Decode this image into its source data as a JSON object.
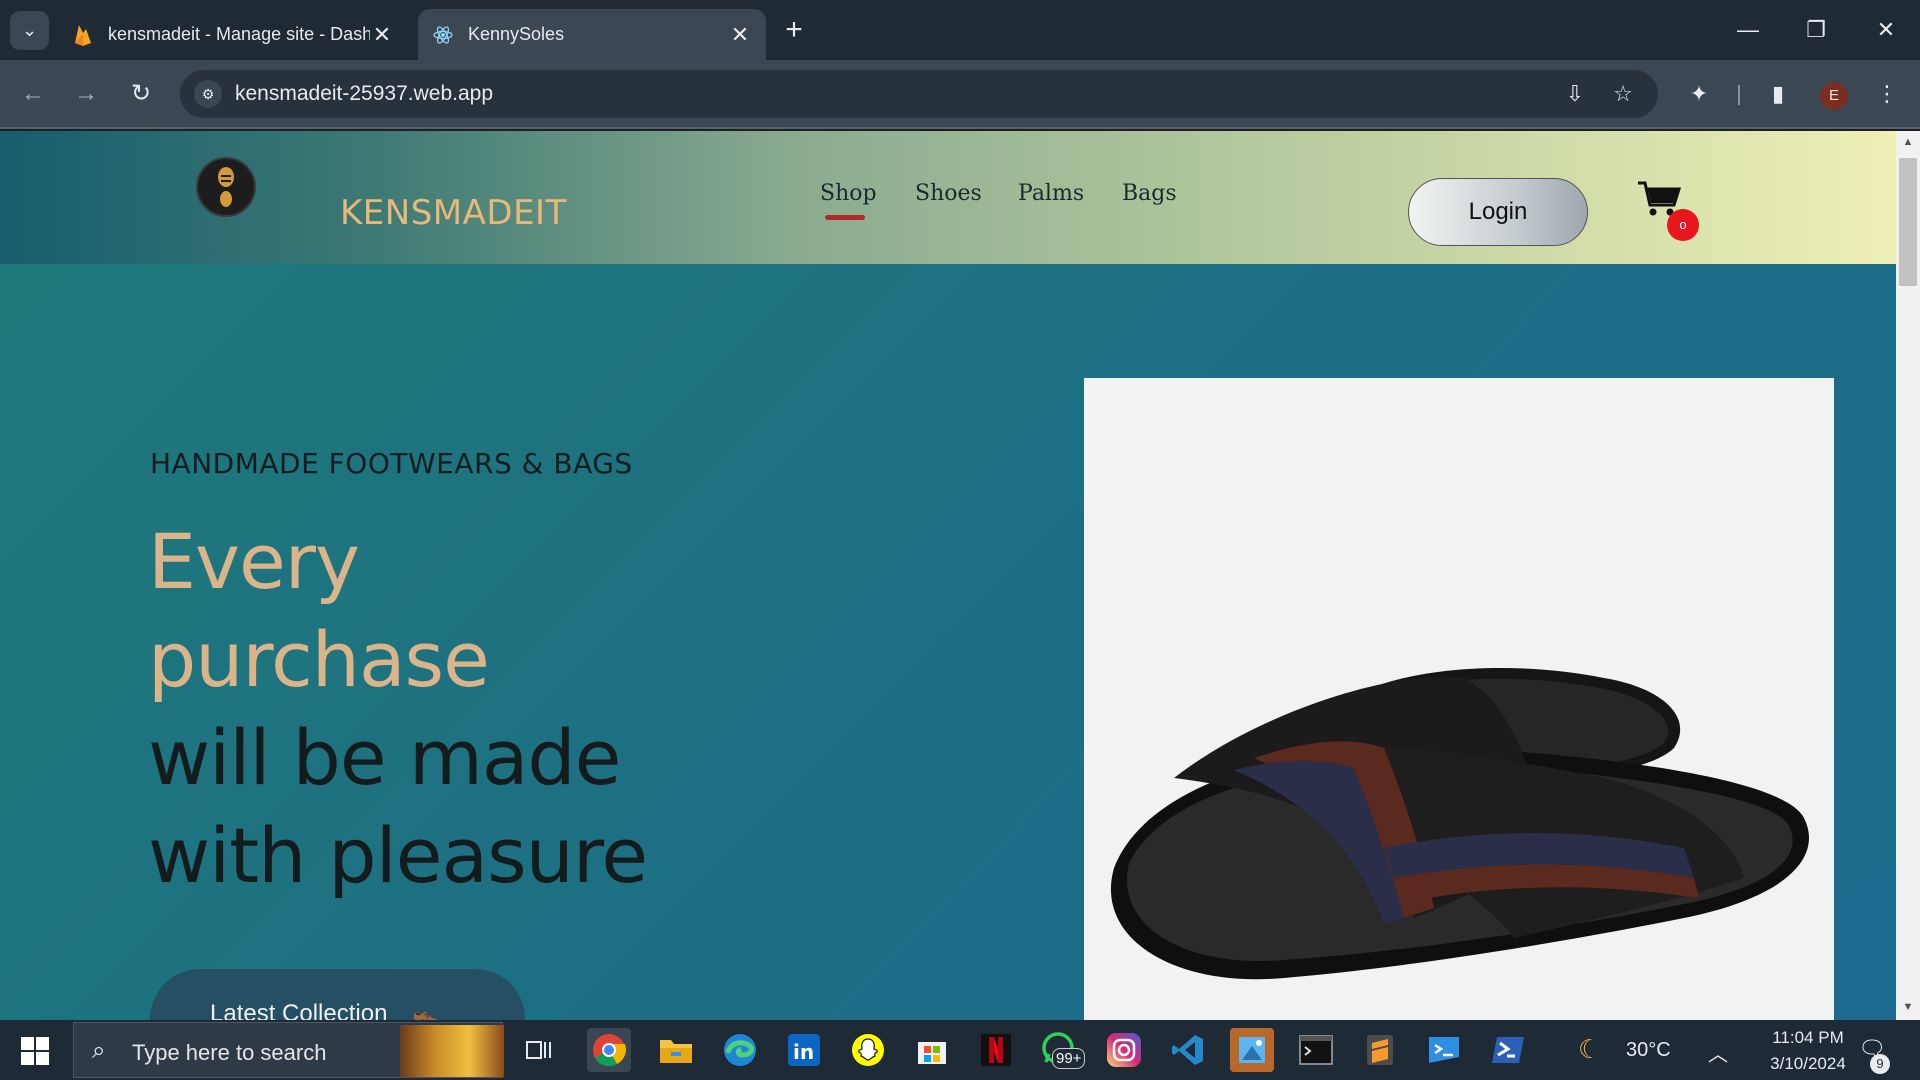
{
  "browser": {
    "tabs": [
      {
        "title": "kensmadeit - Manage site - Dashboard",
        "favicon": "firebase-icon"
      },
      {
        "title": "KennySoles",
        "favicon": "react-icon",
        "active": true
      }
    ],
    "url": "kensmadeit-25937.web.app",
    "profile_initial": "E"
  },
  "site": {
    "brand": "KENSMADEIT",
    "nav": [
      "Shop",
      "Shoes",
      "Palms",
      "Bags"
    ],
    "active_nav": "Shop",
    "login_label": "Login",
    "cart_count": "o"
  },
  "hero": {
    "kicker": "HANDMADE FOOTWEARS & BAGS",
    "line1": "Every",
    "line2": "purchase",
    "line3": "will be made",
    "line4": "with pleasure",
    "cta": "Latest Collection"
  },
  "taskbar": {
    "search_placeholder": "Type here to search",
    "whatsapp_badge": "99+",
    "temperature": "30°C",
    "time": "11:04 PM",
    "date": "3/10/2024",
    "notification_count": "9"
  },
  "colors": {
    "brand_gold": "#e9b97a",
    "hero_accent": "#dbb48a",
    "cart_badge": "#e8161d",
    "nav_active_underline": "#b32828"
  }
}
